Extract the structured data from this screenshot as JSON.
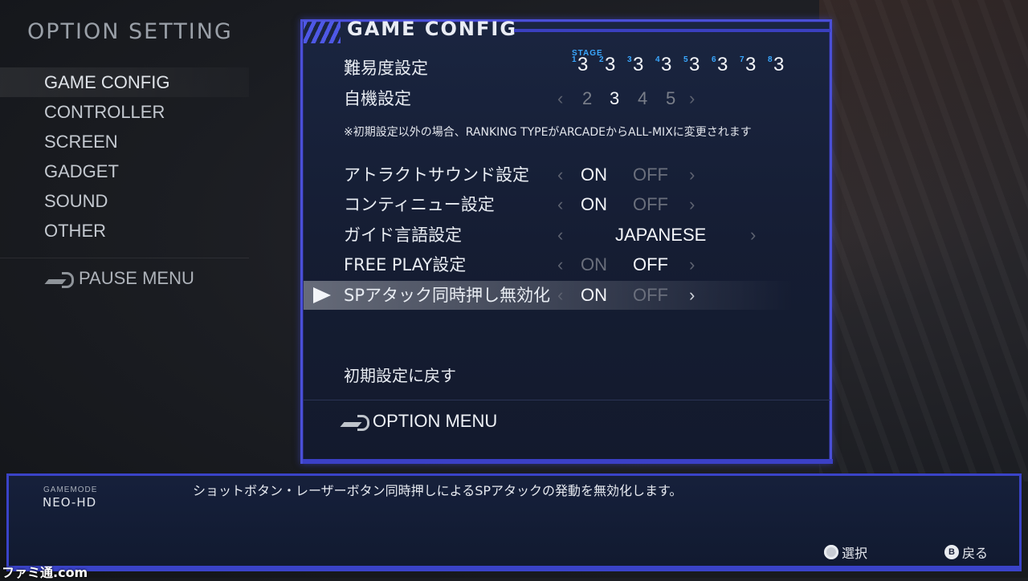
{
  "sidebar": {
    "title": "OPTION SETTING",
    "items": [
      {
        "label": "GAME CONFIG"
      },
      {
        "label": "CONTROLLER"
      },
      {
        "label": "SCREEN"
      },
      {
        "label": "GADGET"
      },
      {
        "label": "SOUND"
      },
      {
        "label": "OTHER"
      }
    ],
    "back_label": "PAUSE MENU"
  },
  "panel": {
    "title": "GAME CONFIG",
    "difficulty": {
      "label": "難易度設定",
      "stage_header": "STAGE",
      "stages": [
        {
          "n": "1",
          "v": "3"
        },
        {
          "n": "2",
          "v": "3"
        },
        {
          "n": "3",
          "v": "3"
        },
        {
          "n": "4",
          "v": "3"
        },
        {
          "n": "5",
          "v": "3"
        },
        {
          "n": "6",
          "v": "3"
        },
        {
          "n": "7",
          "v": "3"
        },
        {
          "n": "8",
          "v": "3"
        }
      ]
    },
    "ship": {
      "label": "自機設定",
      "arrow_left": "‹",
      "arrow_right": "›",
      "options": [
        "2",
        "3",
        "4",
        "5"
      ],
      "selected": "3"
    },
    "note": "※初期設定以外の場合、RANKING TYPEがARCADEからALL-MIXに変更されます",
    "settings": [
      {
        "label": "アトラクトサウンド設定",
        "on": "ON",
        "off": "OFF",
        "value": "ON"
      },
      {
        "label": "コンティニュー設定",
        "on": "ON",
        "off": "OFF",
        "value": "ON"
      },
      {
        "label": "ガイド言語設定",
        "value_text": "JAPANESE"
      },
      {
        "label": "FREE PLAY設定",
        "on": "ON",
        "off": "OFF",
        "value": "OFF"
      },
      {
        "label": "SPアタック同時押し無効化",
        "on": "ON",
        "off": "OFF",
        "value": "ON",
        "selected": true
      }
    ],
    "reset_label": "初期設定に戻す",
    "option_menu_label": "OPTION MENU"
  },
  "footer": {
    "gamemode_label": "GAMEMODE",
    "gamemode_value": "NEO-HD",
    "description": "ショットボタン・レーザーボタン同時押しによるSPアタックの発動を無効化します。",
    "hint_select": "選択",
    "hint_back": "戻る",
    "hint_back_button": "B"
  },
  "watermark": "ファミ通.com",
  "colors": {
    "accent": "#4a4fd8",
    "stage_number": "#3aa8ff",
    "panel_bg": "#151d33"
  }
}
